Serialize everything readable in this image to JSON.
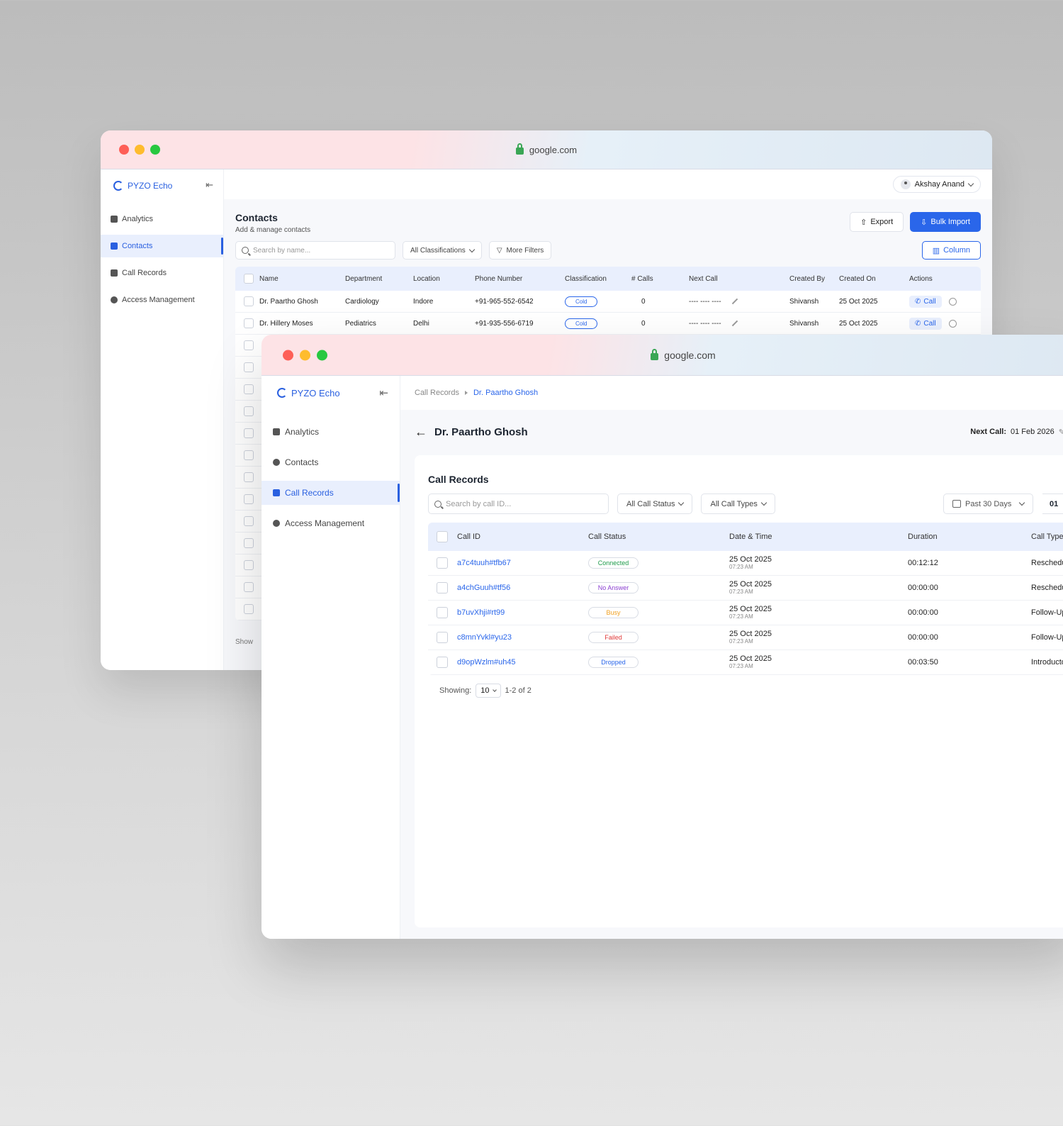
{
  "back_window": {
    "url": "google.com",
    "logo": "PYZO Echo",
    "nav": [
      {
        "label": "Analytics",
        "icon": "analytics-icon"
      },
      {
        "label": "Contacts",
        "icon": "person-icon",
        "active": true
      },
      {
        "label": "Call Records",
        "icon": "voicemail-icon"
      },
      {
        "label": "Access Management",
        "icon": "gear-icon"
      }
    ],
    "user": "Akshay Anand",
    "page_title": "Contacts",
    "page_subtitle": "Add & manage contacts",
    "export_label": "Export",
    "bulk_import_label": "Bulk Import",
    "search_placeholder": "Search by name...",
    "classification_filter": "All Classifications",
    "more_filters": "More Filters",
    "column_label": "Column",
    "columns": [
      "Name",
      "Department",
      "Location",
      "Phone Number",
      "Classification",
      "# Calls",
      "Next Call",
      "Created By",
      "Created On",
      "Actions"
    ],
    "rows": [
      {
        "name": "Dr. Paartho Ghosh",
        "department": "Cardiology",
        "location": "Indore",
        "phone": "+91-965-552-6542",
        "classification": "Cold",
        "calls": "0",
        "next_call": "---- ---- ----",
        "created_by": "Shivansh",
        "created_on": "25 Oct 2025",
        "action": "Call"
      },
      {
        "name": "Dr. Hillery Moses",
        "department": "Pediatrics",
        "location": "Delhi",
        "phone": "+91-935-556-6719",
        "classification": "Cold",
        "calls": "0",
        "next_call": "---- ---- ----",
        "created_by": "Shivansh",
        "created_on": "25 Oct 2025",
        "action": "Call"
      }
    ],
    "footer_stub": "Show"
  },
  "front_window": {
    "url": "google.com",
    "logo": "PYZO Echo",
    "nav": [
      {
        "label": "Analytics",
        "icon": "analytics-icon"
      },
      {
        "label": "Contacts",
        "icon": "person-icon"
      },
      {
        "label": "Call Records",
        "icon": "voicemail-icon",
        "active": true
      },
      {
        "label": "Access Management",
        "icon": "gear-icon"
      }
    ],
    "breadcrumb": [
      "Call Records",
      "Dr. Paartho Ghosh"
    ],
    "title": "Dr. Paartho Ghosh",
    "next_call_label": "Next Call:",
    "next_call_value": "01 Feb 2026",
    "panel_title": "Call Records",
    "search_placeholder": "Search by call ID...",
    "status_filter": "All Call Status",
    "type_filter": "All Call Types",
    "date_filter": "Past 30 Days",
    "date_extra": "01",
    "columns": [
      "Call ID",
      "Call Status",
      "Date & Time",
      "Duration",
      "Call Type"
    ],
    "rows": [
      {
        "id": "a7c4tuuh#tfb67",
        "status": "Connected",
        "status_color": "#1e9b4a",
        "date": "25 Oct 2025",
        "time": "07:23 AM",
        "duration": "00:12:12",
        "type": "Reschedule"
      },
      {
        "id": "a4chGuuh#tf56",
        "status": "No Answer",
        "status_color": "#8a3fd1",
        "date": "25 Oct 2025",
        "time": "07:23 AM",
        "duration": "00:00:00",
        "type": "Reschedule"
      },
      {
        "id": "b7uvXhji#rt99",
        "status": "Busy",
        "status_color": "#f0a020",
        "date": "25 Oct 2025",
        "time": "07:23 AM",
        "duration": "00:00:00",
        "type": "Follow-Up"
      },
      {
        "id": "c8mnYvkl#yu23",
        "status": "Failed",
        "status_color": "#e03a3a",
        "date": "25 Oct 2025",
        "time": "07:23 AM",
        "duration": "00:00:00",
        "type": "Follow-Up"
      },
      {
        "id": "d9opWzlm#uh45",
        "status": "Dropped",
        "status_color": "#2a66ea",
        "date": "25 Oct 2025",
        "time": "07:23 AM",
        "duration": "00:03:50",
        "type": "Introducto"
      }
    ],
    "showing_label": "Showing:",
    "page_size": "10",
    "range": "1-2 of 2"
  }
}
